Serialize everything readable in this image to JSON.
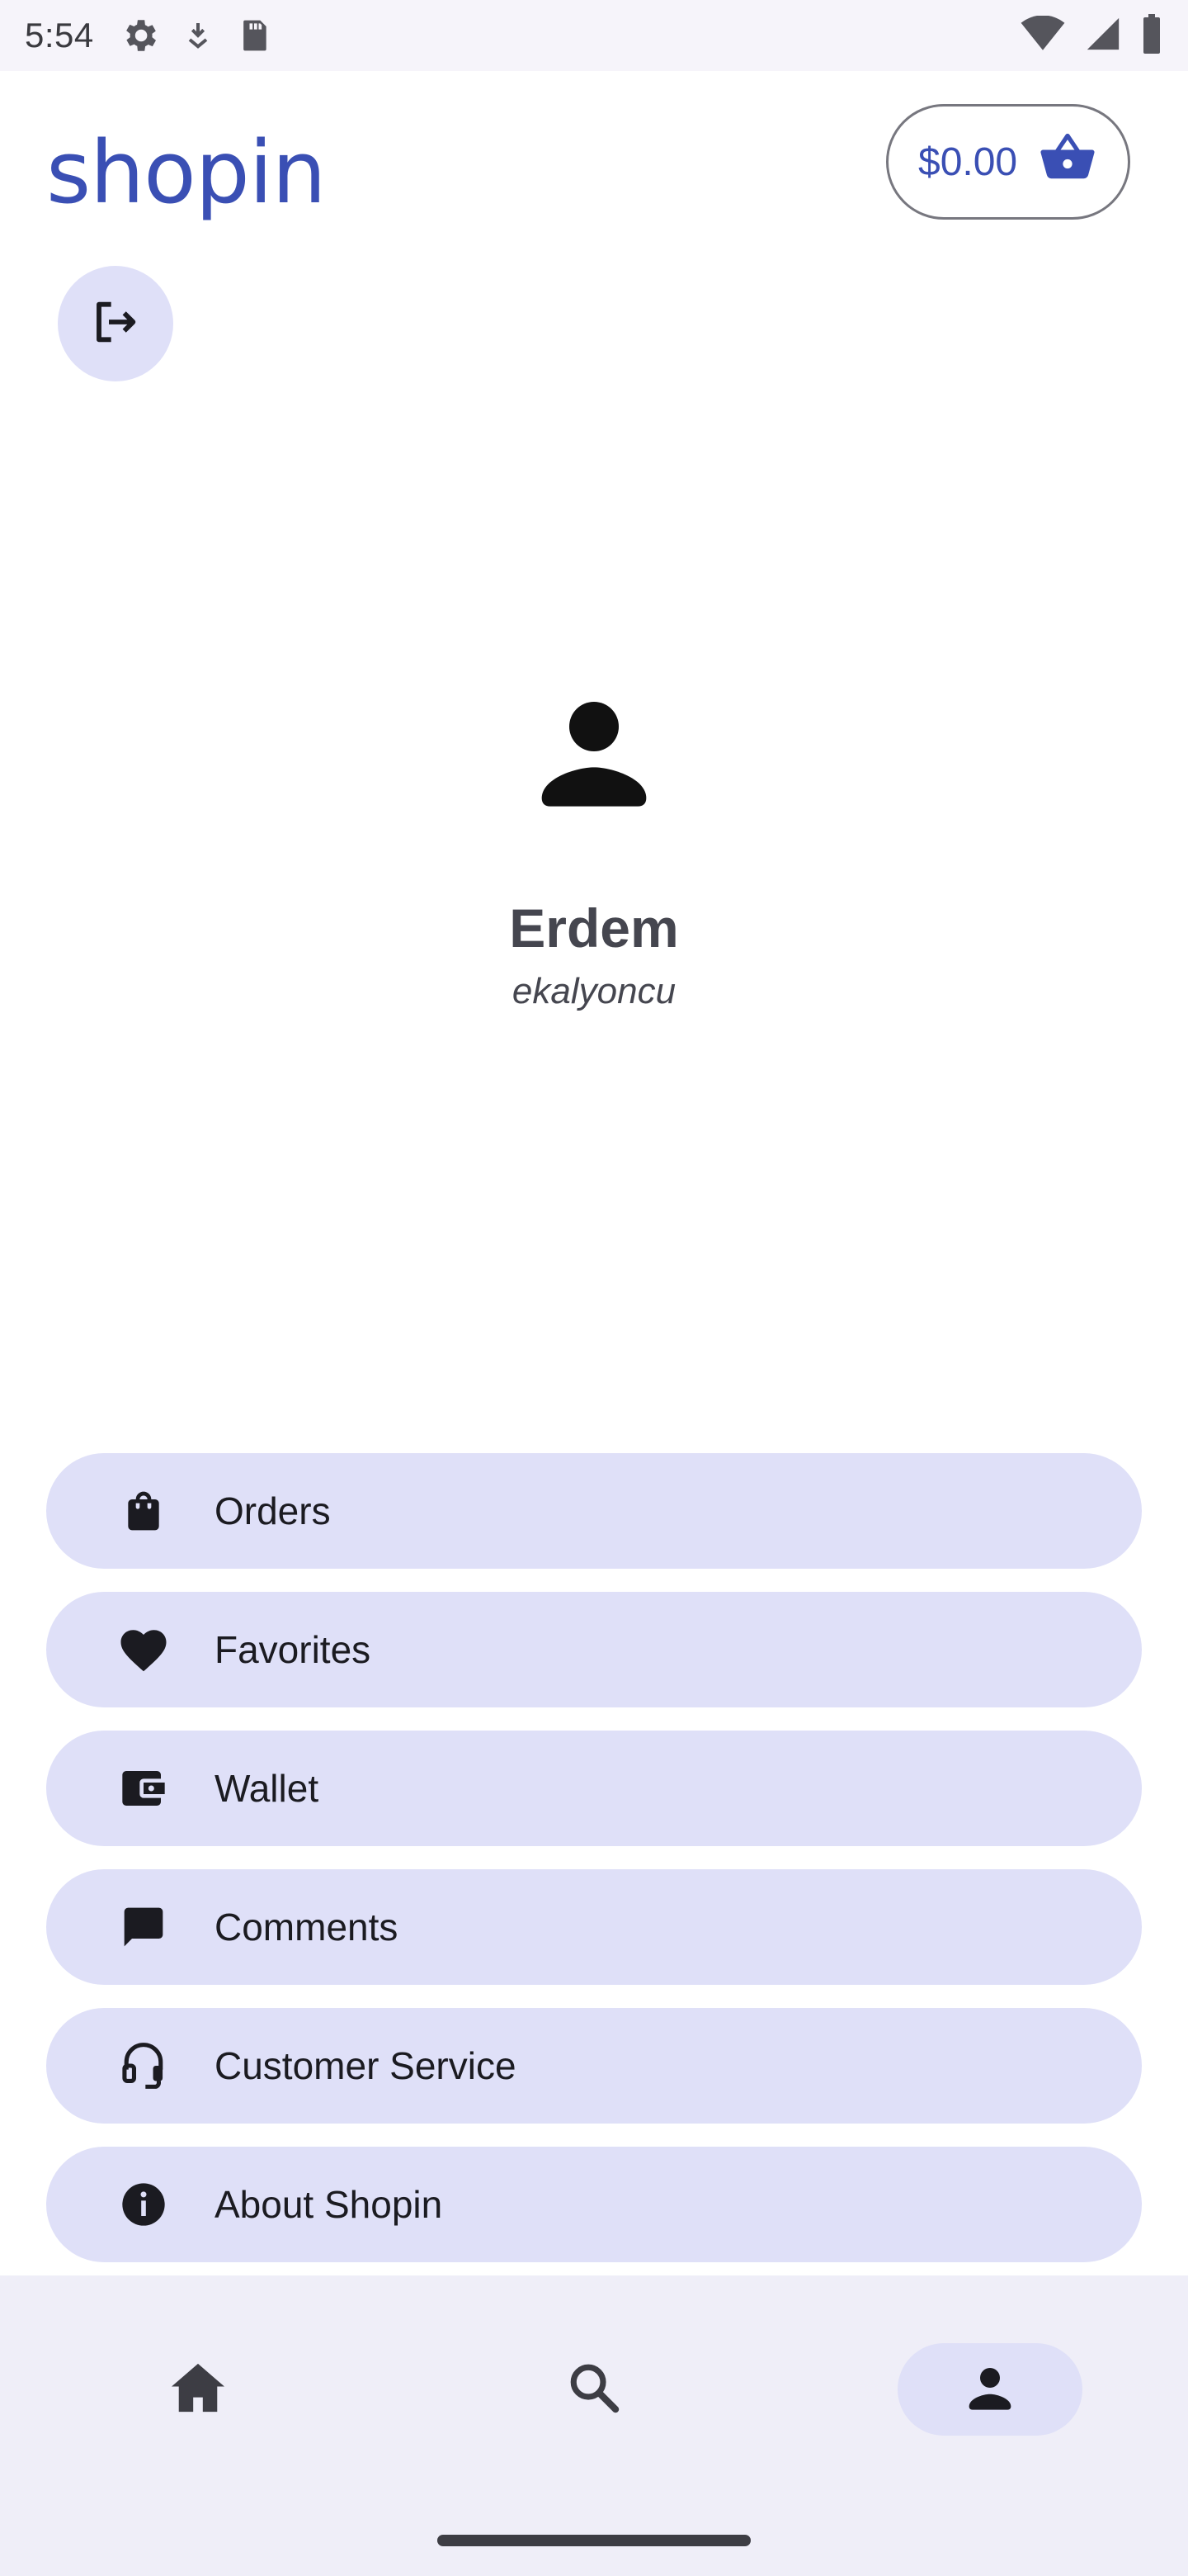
{
  "status_bar": {
    "time": "5:54",
    "icons": [
      "settings-gear-icon",
      "download-icon",
      "sd-card-icon",
      "wifi-icon",
      "signal-icon",
      "battery-icon"
    ]
  },
  "header": {
    "logo": "shopin",
    "cart_total": "$0.00",
    "cart_icon": "basket-icon",
    "logout_icon": "logout-icon"
  },
  "profile": {
    "name": "Erdem",
    "username": "ekalyoncu",
    "avatar_icon": "person-icon"
  },
  "menu": {
    "items": [
      {
        "label": "Orders",
        "icon": "shopping-bag-icon"
      },
      {
        "label": "Favorites",
        "icon": "heart-icon"
      },
      {
        "label": "Wallet",
        "icon": "wallet-icon"
      },
      {
        "label": "Comments",
        "icon": "comment-icon"
      },
      {
        "label": "Customer Service",
        "icon": "headset-icon"
      },
      {
        "label": "About Shopin",
        "icon": "info-icon"
      }
    ]
  },
  "bottom_nav": {
    "items": [
      {
        "name": "home",
        "icon": "home-icon",
        "active": false
      },
      {
        "name": "search",
        "icon": "search-icon",
        "active": false
      },
      {
        "name": "profile",
        "icon": "person-icon",
        "active": true
      }
    ]
  },
  "colors": {
    "brand": "#3a4fb4",
    "menu_bg": "#dfe0f8",
    "nav_bg": "#efeef8",
    "text_dark": "#1b1b21",
    "text_muted": "#45464f"
  }
}
